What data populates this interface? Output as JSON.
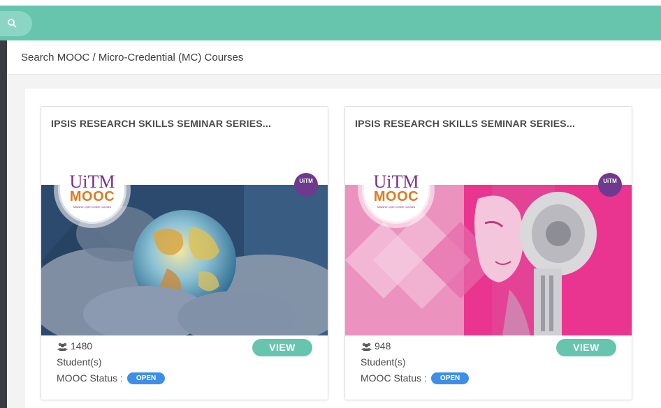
{
  "header": {
    "search_icon": "search-icon"
  },
  "page": {
    "title": "Search MOOC / Micro-Credential (MC) Courses"
  },
  "logo": {
    "uitm": "UiTM",
    "mooc": "MOOC",
    "tagline": "Massive Open Online Courses",
    "corner_badge": "UiTM"
  },
  "courses": [
    {
      "title": "IPSIS RESEARCH SKILLS SEMINAR SERIES...",
      "students": "1480",
      "students_label": "Student(s)",
      "status_label": "MOOC Status :",
      "status": "OPEN",
      "view_label": "VIEW",
      "image": "globe-in-hands"
    },
    {
      "title": "IPSIS RESEARCH SKILLS SEMINAR SERIES...",
      "students": "948",
      "students_label": "Student(s)",
      "status_label": "MOOC Status :",
      "status": "OPEN",
      "view_label": "VIEW",
      "image": "robot-face-magenta"
    }
  ],
  "colors": {
    "accent": "#67c5ae",
    "status": "#3d8ee8",
    "sidebar": "#3b3b44",
    "brand_purple": "#7a2e86",
    "brand_orange": "#e07a1f"
  }
}
